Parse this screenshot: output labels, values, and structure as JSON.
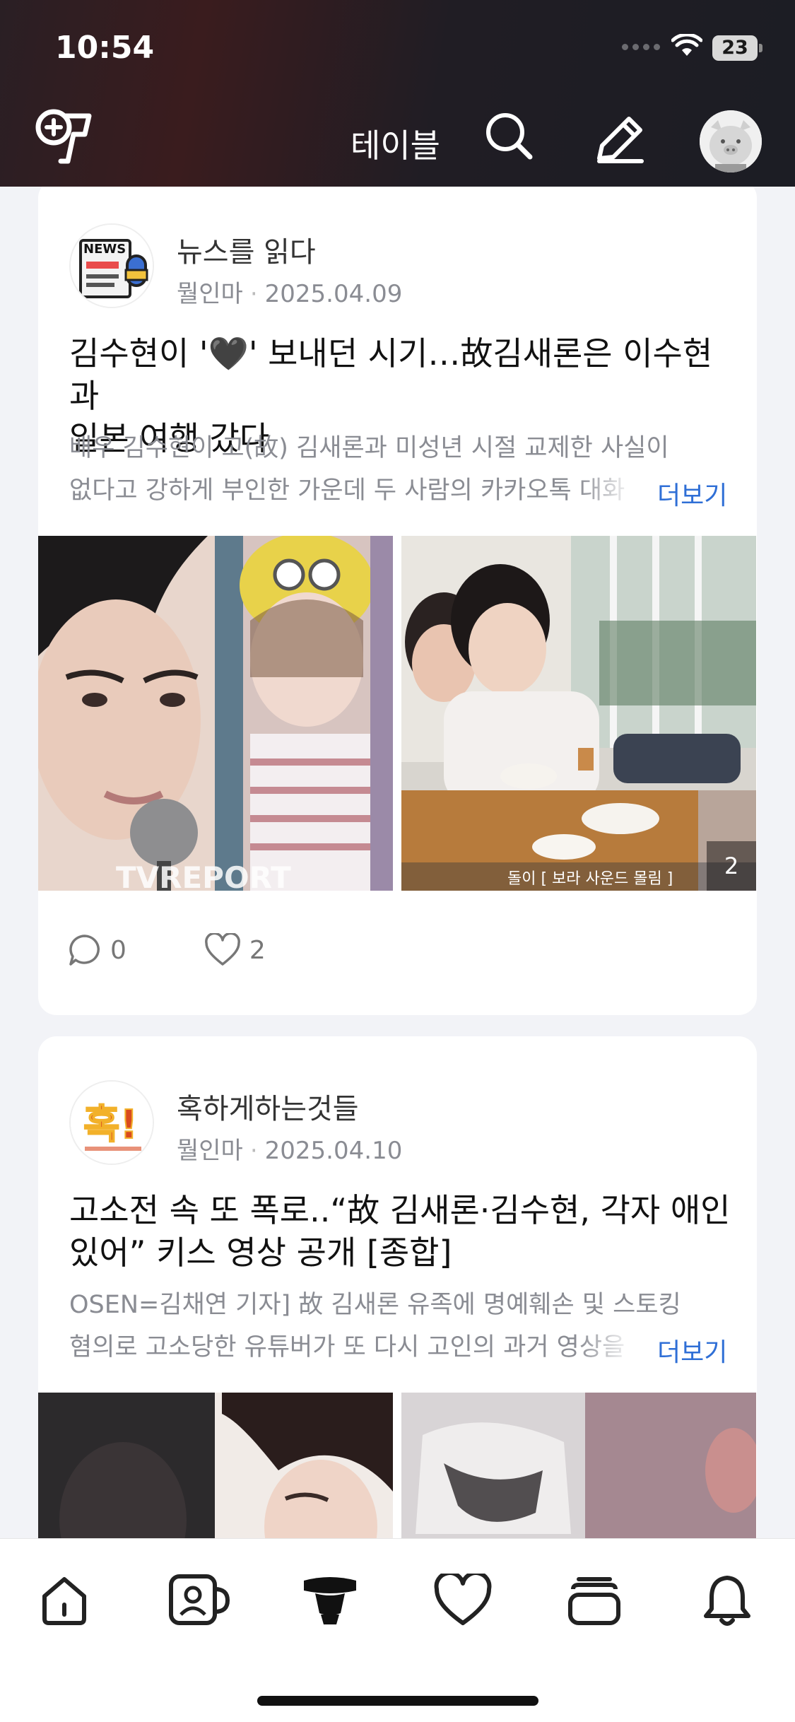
{
  "status_bar": {
    "time": "10:54",
    "battery": "23"
  },
  "header": {
    "logo_icon": "table-logo-icon",
    "title": "테이블",
    "search_icon": "search-icon",
    "edit_icon": "pencil-icon",
    "avatar": "profile-avatar"
  },
  "posts": [
    {
      "author": "뉴스를 읽다",
      "category": "뭘인마",
      "date": "2025.04.09",
      "title_line1": "김수현이 '🖤' 보내던 시기…故김새론은 이수현과",
      "title_line2": "일본 여행 갔다",
      "excerpt_line1": "배우 김수현이 고(故) 김새론과 미성년 시절 교제한 사실이",
      "excerpt_line2": "없다고 강하게 부인한 가운데 두 사람의 카카오톡 대화",
      "more": "더보기",
      "photo_count": "2",
      "photo_caption_left": "TVREPORT",
      "photo_caption_right": "돌이 [ 보라 사운드 몰림 ]",
      "comments": "0",
      "likes": "2"
    },
    {
      "author": "혹하게하는것들",
      "category": "뭘인마",
      "date": "2025.04.10",
      "title_line1": "고소전 속 또 폭로..“故 김새론·김수현, 각자 애인",
      "title_line2": "있어” 키스 영상 공개 [종합]",
      "excerpt_line1": "OSEN=김채연 기자] 故 김새론 유족에 명예훼손 및 스토킹",
      "excerpt_line2": "혐의로 고소당한 유튜버가 또 다시 고인의 과거 영상을",
      "more": "더보기",
      "avatar_text": "혹!"
    }
  ],
  "tabs": [
    {
      "name": "home",
      "icon": "home-icon"
    },
    {
      "name": "profile",
      "icon": "profile-card-icon"
    },
    {
      "name": "table",
      "icon": "table-icon",
      "active": true
    },
    {
      "name": "likes",
      "icon": "heart-icon"
    },
    {
      "name": "stack",
      "icon": "stack-icon"
    },
    {
      "name": "notifications",
      "icon": "bell-icon"
    }
  ],
  "colors": {
    "accent_link": "#2f6fd6",
    "header_bg": "#1f1d24",
    "meta_text": "#8a8c93"
  }
}
